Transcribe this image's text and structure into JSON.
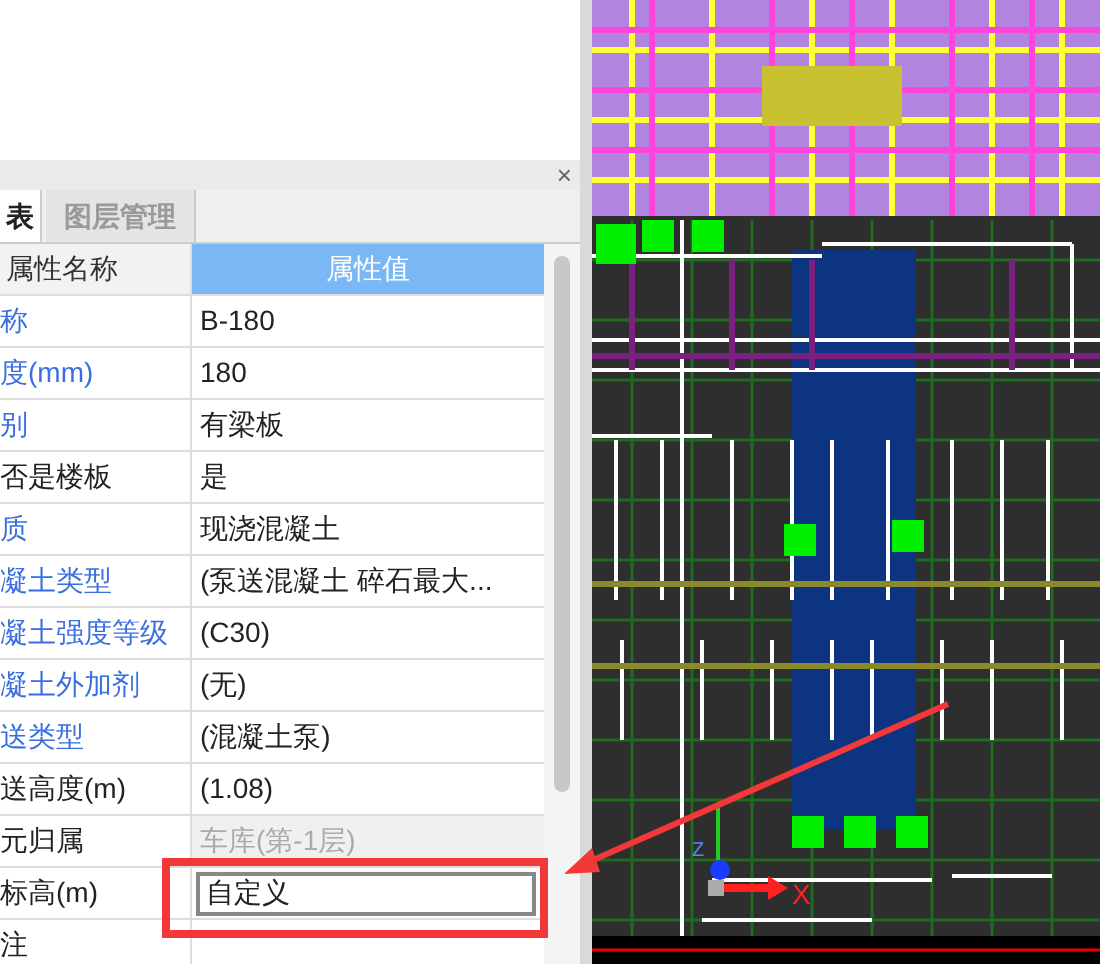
{
  "panel": {
    "close": "×",
    "tabs": [
      {
        "label": "表",
        "selected": true
      },
      {
        "label": "图层管理",
        "selected": false
      }
    ],
    "columns": [
      "属性名称",
      "属性值"
    ],
    "rows": [
      {
        "name": "称",
        "value": "B-180",
        "public": true,
        "disabled": false,
        "editing": false
      },
      {
        "name": "度(mm)",
        "value": "180",
        "public": true,
        "disabled": false,
        "editing": false
      },
      {
        "name": "别",
        "value": "有梁板",
        "public": true,
        "disabled": false,
        "editing": false
      },
      {
        "name": "否是楼板",
        "value": "是",
        "public": false,
        "disabled": false,
        "editing": false
      },
      {
        "name": "质",
        "value": "现浇混凝土",
        "public": true,
        "disabled": false,
        "editing": false
      },
      {
        "name": "凝土类型",
        "value": "(泵送混凝土 碎石最大...",
        "public": true,
        "disabled": false,
        "editing": false
      },
      {
        "name": "凝土强度等级",
        "value": "(C30)",
        "public": true,
        "disabled": false,
        "editing": false
      },
      {
        "name": "凝土外加剂",
        "value": "(无)",
        "public": true,
        "disabled": false,
        "editing": false
      },
      {
        "name": "送类型",
        "value": "(混凝土泵)",
        "public": true,
        "disabled": false,
        "editing": false
      },
      {
        "name": "送高度(m)",
        "value": "(1.08)",
        "public": false,
        "disabled": false,
        "editing": false
      },
      {
        "name": "元归属",
        "value": "车库(第-1层)",
        "public": false,
        "disabled": true,
        "editing": false
      },
      {
        "name": "标高(m)",
        "value": "自定义",
        "public": false,
        "disabled": false,
        "editing": true
      },
      {
        "name": "注",
        "value": "",
        "public": false,
        "disabled": false,
        "editing": false
      }
    ]
  },
  "canvas": {
    "axes": {
      "x": "X",
      "z": "Z"
    }
  }
}
